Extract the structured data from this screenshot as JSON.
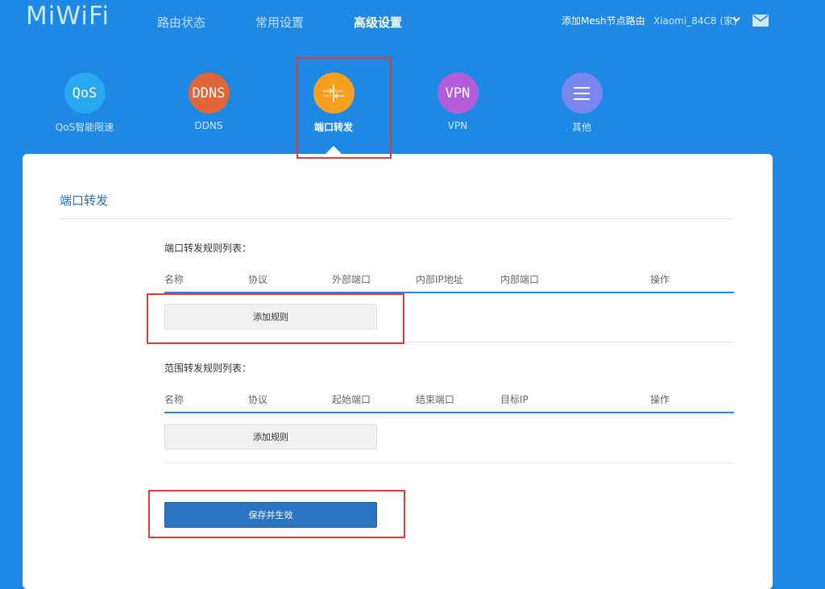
{
  "brand": {
    "logo": "MiWiFi"
  },
  "top_nav": [
    {
      "label": "路由状态",
      "active": false
    },
    {
      "label": "常用设置",
      "active": false
    },
    {
      "label": "高级设置",
      "active": true
    }
  ],
  "header_right": {
    "mesh_link": "添加Mesh节点路由",
    "router_name": "Xiaomi_84C8 (家)"
  },
  "categories": [
    {
      "icon_text": "QoS",
      "label": "QoS智能限速",
      "color": "#29a8f0"
    },
    {
      "icon_text": "DDNS",
      "label": "DDNS",
      "color": "#e0663a"
    },
    {
      "icon_text": "",
      "label": "端口转发",
      "color": "#f7a020",
      "active": true
    },
    {
      "icon_text": "VPN",
      "label": "VPN",
      "color": "#b35ed8"
    },
    {
      "icon_text": "",
      "label": "其他",
      "color": "#7a86f0"
    }
  ],
  "section_title": "端口转发",
  "port_rules": {
    "title": "端口转发规则列表：",
    "columns": [
      "名称",
      "协议",
      "外部端口",
      "内部IP地址",
      "内部端口",
      "操作"
    ],
    "add_label": "添加规则"
  },
  "range_rules": {
    "title": "范围转发规则列表：",
    "columns": [
      "名称",
      "协议",
      "起始端口",
      "结束端口",
      "目标IP",
      "操作"
    ],
    "add_label": "添加规则"
  },
  "save_label": "保存并生效",
  "colors": {
    "background": "#1e88e5",
    "primary_button": "#2b74c2",
    "highlight_box": "#e53935"
  }
}
